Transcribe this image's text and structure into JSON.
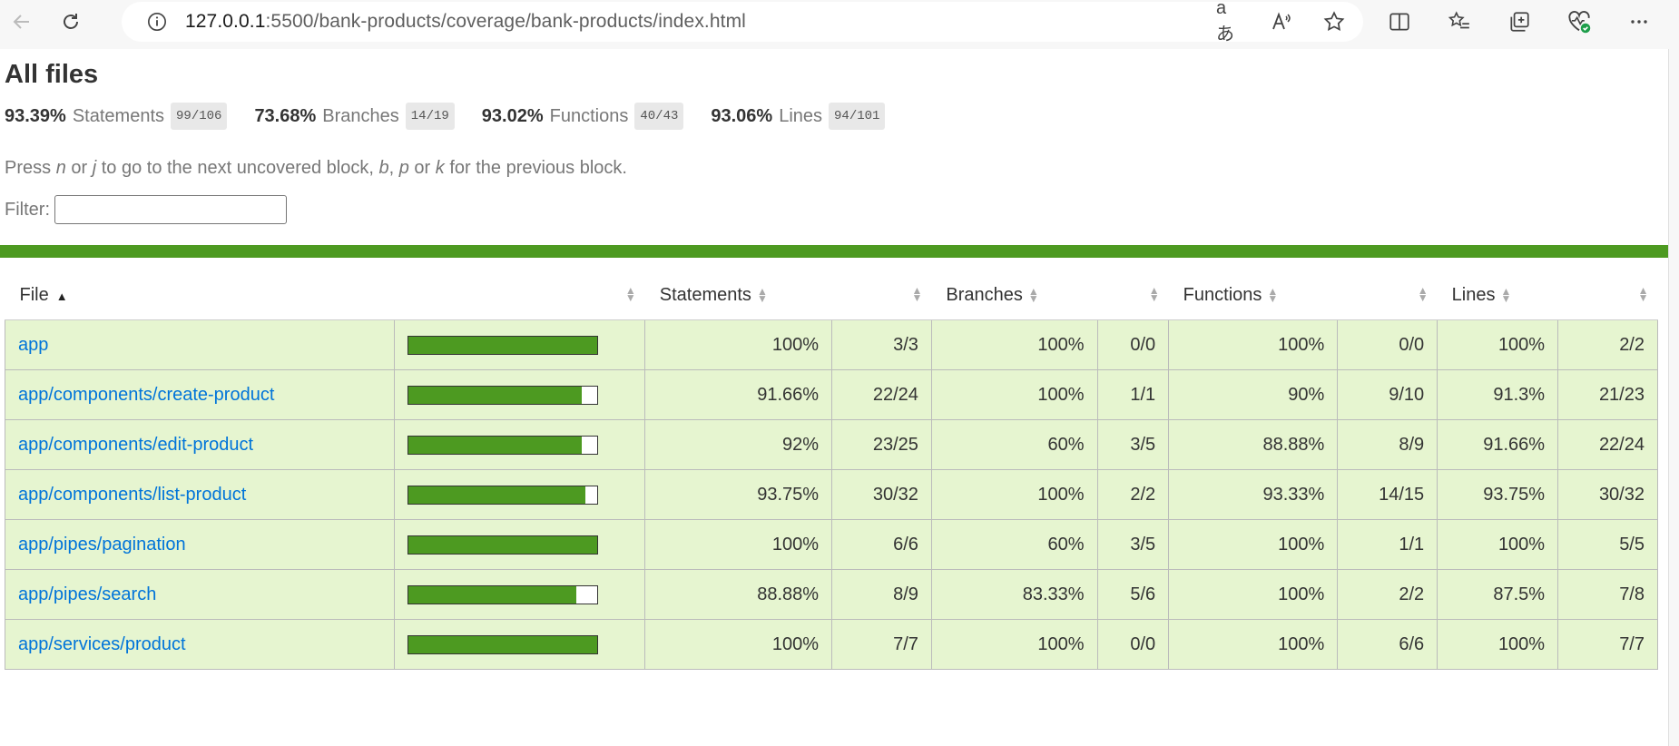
{
  "browser": {
    "url_host": "127.0.0.1",
    "url_rest": ":5500/bank-products/coverage/bank-products/index.html"
  },
  "page": {
    "title": "All files",
    "summary": [
      {
        "pct": "93.39%",
        "label": "Statements",
        "fraction": "99/106"
      },
      {
        "pct": "73.68%",
        "label": "Branches",
        "fraction": "14/19"
      },
      {
        "pct": "93.02%",
        "label": "Functions",
        "fraction": "40/43"
      },
      {
        "pct": "93.06%",
        "label": "Lines",
        "fraction": "94/101"
      }
    ],
    "hint_parts": [
      "Press ",
      "n",
      " or ",
      "j",
      " to go to the next uncovered block, ",
      "b",
      ", ",
      "p",
      " or ",
      "k",
      " for the previous block."
    ],
    "filter_label": "Filter:",
    "filter_value": ""
  },
  "table": {
    "headers": {
      "file": "File",
      "statements": "Statements",
      "branches": "Branches",
      "functions": "Functions",
      "lines": "Lines"
    },
    "rows": [
      {
        "file": "app",
        "bar_fraction": 1.0,
        "stmt_pct": "100%",
        "stmt_frac": "3/3",
        "br_pct": "100%",
        "br_frac": "0/0",
        "fn_pct": "100%",
        "fn_frac": "0/0",
        "ln_pct": "100%",
        "ln_frac": "2/2",
        "br_level": "high"
      },
      {
        "file": "app/components/create-product",
        "bar_fraction": 0.9166,
        "stmt_pct": "91.66%",
        "stmt_frac": "22/24",
        "br_pct": "100%",
        "br_frac": "1/1",
        "fn_pct": "90%",
        "fn_frac": "9/10",
        "ln_pct": "91.3%",
        "ln_frac": "21/23",
        "br_level": "high"
      },
      {
        "file": "app/components/edit-product",
        "bar_fraction": 0.92,
        "stmt_pct": "92%",
        "stmt_frac": "23/25",
        "br_pct": "60%",
        "br_frac": "3/5",
        "fn_pct": "88.88%",
        "fn_frac": "8/9",
        "ln_pct": "91.66%",
        "ln_frac": "22/24",
        "br_level": "medium"
      },
      {
        "file": "app/components/list-product",
        "bar_fraction": 0.9375,
        "stmt_pct": "93.75%",
        "stmt_frac": "30/32",
        "br_pct": "100%",
        "br_frac": "2/2",
        "fn_pct": "93.33%",
        "fn_frac": "14/15",
        "ln_pct": "93.75%",
        "ln_frac": "30/32",
        "br_level": "high"
      },
      {
        "file": "app/pipes/pagination",
        "bar_fraction": 1.0,
        "stmt_pct": "100%",
        "stmt_frac": "6/6",
        "br_pct": "60%",
        "br_frac": "3/5",
        "fn_pct": "100%",
        "fn_frac": "1/1",
        "ln_pct": "100%",
        "ln_frac": "5/5",
        "br_level": "medium"
      },
      {
        "file": "app/pipes/search",
        "bar_fraction": 0.8888,
        "stmt_pct": "88.88%",
        "stmt_frac": "8/9",
        "br_pct": "83.33%",
        "br_frac": "5/6",
        "fn_pct": "100%",
        "fn_frac": "2/2",
        "ln_pct": "87.5%",
        "ln_frac": "7/8",
        "br_level": "high"
      },
      {
        "file": "app/services/product",
        "bar_fraction": 1.0,
        "stmt_pct": "100%",
        "stmt_frac": "7/7",
        "br_pct": "100%",
        "br_frac": "0/0",
        "fn_pct": "100%",
        "fn_frac": "6/6",
        "ln_pct": "100%",
        "ln_frac": "7/7",
        "br_level": "high"
      }
    ]
  },
  "colors": {
    "high": "#e6f5d0",
    "medium": "#fff4c2",
    "bar_fill": "#4d9a21",
    "link": "#0074d9"
  },
  "icons": [
    "back-arrow-icon",
    "refresh-icon",
    "info-icon",
    "read-translate-icon",
    "read-aloud-icon",
    "favorite-star-icon",
    "split-screen-icon",
    "favorites-list-icon",
    "collections-icon",
    "browser-essentials-icon",
    "more-icon"
  ]
}
